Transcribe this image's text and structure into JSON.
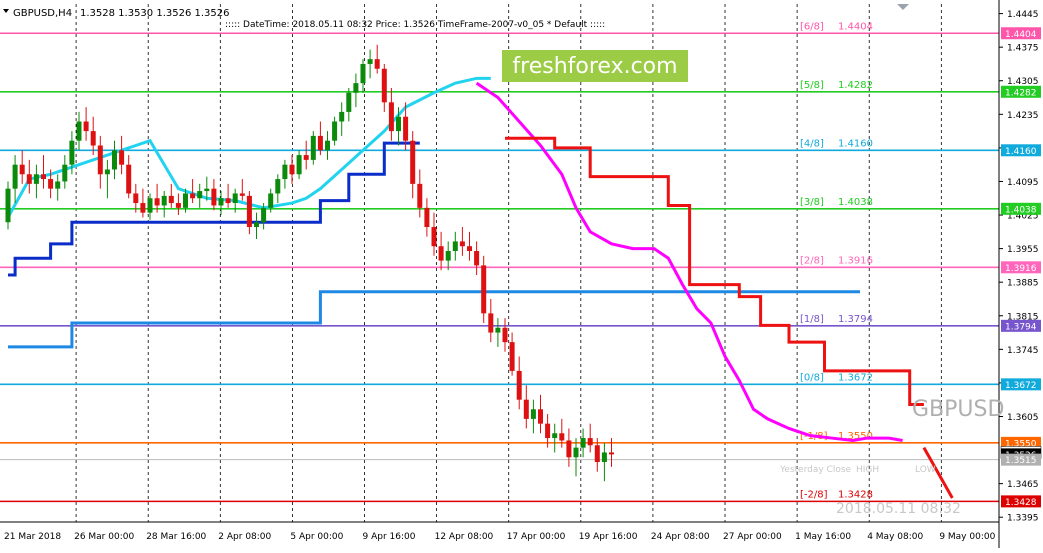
{
  "header": {
    "symbol": "GBPUSD,H4",
    "ohlc": "1.3528 1.3530 1.3526 1.3526",
    "info": ":::::  DateTime: 2018.05.11 08:32    Price: 1.3526   TimeFrame-2007-v0_05    *    Default    :::::"
  },
  "watermark": "freshforex.com",
  "symbol_label": "GBPUSD",
  "datetime_overlay": "2018.05.11 08:32",
  "colors": {
    "bull": "#0b8a0b",
    "bear": "#dd1111",
    "blue_line": "#0a2cc8",
    "lightblue_line": "#1e88e5",
    "cyan_line": "#22d3f0",
    "magenta_line": "#ff00ff",
    "red_line": "#ee1111"
  },
  "chart_data": {
    "type": "candlestick",
    "ylim": [
      1.3385,
      1.4465
    ],
    "time_labels": [
      "21 Mar 2018",
      "26 Mar 00:00",
      "28 Mar 16:00",
      "2 Apr 08:00",
      "5 Apr 00:00",
      "9 Apr 16:00",
      "12 Apr 08:00",
      "17 Apr 00:00",
      "19 Apr 16:00",
      "24 Apr 08:00",
      "27 Apr 00:00",
      "1 May 16:00",
      "4 May 08:00",
      "9 May 00:00"
    ],
    "price_ticks": [
      "1.4445",
      "1.4375",
      "1.4305",
      "1.4235",
      "1.4165",
      "1.4095",
      "1.4025",
      "1.3955",
      "1.3885",
      "1.3815",
      "1.3745",
      "1.3675",
      "1.3605",
      "1.3465",
      "1.3395"
    ],
    "murrey_levels": [
      {
        "label": "[6/8]",
        "price": 1.4404,
        "tag": "1.4404",
        "color": "#ff55aa"
      },
      {
        "label": "[5/8]",
        "price": 1.4282,
        "tag": "1.4282",
        "color": "#22cc22"
      },
      {
        "label": "[4/8]",
        "price": 1.416,
        "tag": "1.4160",
        "color": "#11aadd"
      },
      {
        "label": "[3/8]",
        "price": 1.4038,
        "tag": "1.4038",
        "color": "#22cc22"
      },
      {
        "label": "[2/8]",
        "price": 1.3916,
        "tag": "1.3916",
        "color": "#ff66bb"
      },
      {
        "label": "[1/8]",
        "price": 1.3794,
        "tag": "1.3794",
        "color": "#7755cc"
      },
      {
        "label": "[0/8]",
        "price": 1.3672,
        "tag": "1.3672",
        "color": "#11aadd"
      },
      {
        "label": "[-1/8]",
        "price": 1.355,
        "tag": "1.3550",
        "color": "#ff6600"
      },
      {
        "label": "[-2/8]",
        "price": 1.3428,
        "tag": "1.3428",
        "color": "#dd0000"
      }
    ],
    "extra_price_tags": [
      {
        "price": 1.353,
        "tag": "1.3530",
        "bg": "#ffffff",
        "fg": "#000000"
      },
      {
        "price": 1.3526,
        "tag": "1.3526",
        "bg": "#000000",
        "fg": "#ffffff"
      },
      {
        "price": 1.3515,
        "tag": "1.3515",
        "bg": "#b0b0b0",
        "fg": "#ffffff"
      }
    ],
    "yesterday_label": "Yesterday Close",
    "hi_label": "HIGH",
    "low_label": "LOW",
    "candles": [
      [
        1.401,
        1.4095,
        1.3995,
        1.408
      ],
      [
        1.408,
        1.415,
        1.405,
        1.413
      ],
      [
        1.413,
        1.416,
        1.409,
        1.411
      ],
      [
        1.411,
        1.414,
        1.407,
        1.409
      ],
      [
        1.409,
        1.413,
        1.406,
        1.411
      ],
      [
        1.411,
        1.415,
        1.408,
        1.41
      ],
      [
        1.41,
        1.412,
        1.406,
        1.408
      ],
      [
        1.408,
        1.411,
        1.4055,
        1.4095
      ],
      [
        1.4095,
        1.415,
        1.408,
        1.413
      ],
      [
        1.413,
        1.42,
        1.411,
        1.418
      ],
      [
        1.418,
        1.424,
        1.416,
        1.422
      ],
      [
        1.422,
        1.425,
        1.418,
        1.42
      ],
      [
        1.42,
        1.423,
        1.415,
        1.417
      ],
      [
        1.417,
        1.419,
        1.408,
        1.411
      ],
      [
        1.411,
        1.414,
        1.406,
        1.412
      ],
      [
        1.412,
        1.418,
        1.41,
        1.416
      ],
      [
        1.416,
        1.419,
        1.411,
        1.413
      ],
      [
        1.413,
        1.415,
        1.406,
        1.407
      ],
      [
        1.407,
        1.409,
        1.403,
        1.405
      ],
      [
        1.405,
        1.408,
        1.402,
        1.403
      ],
      [
        1.403,
        1.407,
        1.4015,
        1.406
      ],
      [
        1.406,
        1.409,
        1.403,
        1.4045
      ],
      [
        1.4045,
        1.4075,
        1.402,
        1.4065
      ],
      [
        1.4065,
        1.409,
        1.404,
        1.405
      ],
      [
        1.405,
        1.407,
        1.4025,
        1.404
      ],
      [
        1.404,
        1.408,
        1.403,
        1.407
      ],
      [
        1.407,
        1.41,
        1.405,
        1.406
      ],
      [
        1.406,
        1.409,
        1.404,
        1.4075
      ],
      [
        1.4075,
        1.4105,
        1.4055,
        1.408
      ],
      [
        1.408,
        1.41,
        1.4035,
        1.4045
      ],
      [
        1.4045,
        1.4075,
        1.4025,
        1.406
      ],
      [
        1.406,
        1.409,
        1.404,
        1.405
      ],
      [
        1.405,
        1.408,
        1.403,
        1.407
      ],
      [
        1.407,
        1.41,
        1.4055,
        1.4065
      ],
      [
        1.4065,
        1.4075,
        1.3985,
        1.4
      ],
      [
        1.4,
        1.403,
        1.3975,
        1.401
      ],
      [
        1.401,
        1.405,
        1.3995,
        1.404
      ],
      [
        1.404,
        1.408,
        1.403,
        1.407
      ],
      [
        1.407,
        1.411,
        1.405,
        1.41
      ],
      [
        1.41,
        1.414,
        1.408,
        1.413
      ],
      [
        1.413,
        1.415,
        1.409,
        1.411
      ],
      [
        1.411,
        1.416,
        1.41,
        1.415
      ],
      [
        1.415,
        1.418,
        1.412,
        1.414
      ],
      [
        1.414,
        1.42,
        1.413,
        1.419
      ],
      [
        1.419,
        1.422,
        1.415,
        1.416
      ],
      [
        1.416,
        1.42,
        1.414,
        1.418
      ],
      [
        1.418,
        1.423,
        1.417,
        1.422
      ],
      [
        1.422,
        1.426,
        1.419,
        1.424
      ],
      [
        1.424,
        1.429,
        1.422,
        1.428
      ],
      [
        1.428,
        1.432,
        1.425,
        1.43
      ],
      [
        1.43,
        1.435,
        1.428,
        1.434
      ],
      [
        1.434,
        1.437,
        1.431,
        1.435
      ],
      [
        1.435,
        1.438,
        1.432,
        1.433
      ],
      [
        1.433,
        1.434,
        1.424,
        1.426
      ],
      [
        1.426,
        1.429,
        1.418,
        1.42
      ],
      [
        1.42,
        1.425,
        1.417,
        1.423
      ],
      [
        1.423,
        1.426,
        1.416,
        1.418
      ],
      [
        1.418,
        1.42,
        1.406,
        1.409
      ],
      [
        1.409,
        1.412,
        1.402,
        1.404
      ],
      [
        1.404,
        1.406,
        1.398,
        1.4
      ],
      [
        1.4,
        1.403,
        1.394,
        1.396
      ],
      [
        1.396,
        1.399,
        1.391,
        1.393
      ],
      [
        1.393,
        1.397,
        1.391,
        1.395
      ],
      [
        1.395,
        1.399,
        1.393,
        1.397
      ],
      [
        1.397,
        1.4,
        1.394,
        1.396
      ],
      [
        1.396,
        1.399,
        1.393,
        1.395
      ],
      [
        1.395,
        1.397,
        1.39,
        1.392
      ],
      [
        1.392,
        1.394,
        1.38,
        1.382
      ],
      [
        1.382,
        1.385,
        1.376,
        1.378
      ],
      [
        1.378,
        1.381,
        1.375,
        1.379
      ],
      [
        1.379,
        1.381,
        1.374,
        1.376
      ],
      [
        1.376,
        1.378,
        1.369,
        1.37
      ],
      [
        1.37,
        1.373,
        1.362,
        1.364
      ],
      [
        1.364,
        1.367,
        1.358,
        1.36
      ],
      [
        1.36,
        1.364,
        1.357,
        1.362
      ],
      [
        1.362,
        1.365,
        1.357,
        1.359
      ],
      [
        1.359,
        1.361,
        1.354,
        1.356
      ],
      [
        1.356,
        1.359,
        1.353,
        1.357
      ],
      [
        1.357,
        1.36,
        1.354,
        1.3555
      ],
      [
        1.3555,
        1.358,
        1.35,
        1.352
      ],
      [
        1.352,
        1.356,
        1.348,
        1.354
      ],
      [
        1.354,
        1.358,
        1.352,
        1.356
      ],
      [
        1.356,
        1.359,
        1.353,
        1.3545
      ],
      [
        1.3545,
        1.356,
        1.349,
        1.351
      ],
      [
        1.351,
        1.355,
        1.347,
        1.353
      ],
      [
        1.353,
        1.356,
        1.35,
        1.3526
      ]
    ],
    "blue_steps": [
      [
        0,
        1.39
      ],
      [
        1,
        1.3935
      ],
      [
        6,
        1.3965
      ],
      [
        9,
        1.401
      ],
      [
        24,
        1.401
      ],
      [
        40,
        1.401
      ],
      [
        44,
        1.4055
      ],
      [
        48,
        1.411
      ],
      [
        53,
        1.4175
      ],
      [
        58,
        1.4175
      ]
    ],
    "lightblue_steps": [
      [
        0,
        1.375
      ],
      [
        9,
        1.38
      ],
      [
        44,
        1.3865
      ],
      [
        120,
        1.3865
      ]
    ],
    "cyan_line": [
      [
        0,
        1.402
      ],
      [
        3,
        1.41
      ],
      [
        6,
        1.411
      ],
      [
        10,
        1.413
      ],
      [
        14,
        1.415
      ],
      [
        18,
        1.417
      ],
      [
        20,
        1.418
      ],
      [
        24,
        1.408
      ],
      [
        28,
        1.406
      ],
      [
        32,
        1.4055
      ],
      [
        36,
        1.404
      ],
      [
        40,
        1.405
      ],
      [
        42,
        1.406
      ],
      [
        44,
        1.408
      ],
      [
        47,
        1.412
      ],
      [
        50,
        1.416
      ],
      [
        53,
        1.42
      ],
      [
        56,
        1.425
      ],
      [
        60,
        1.428
      ],
      [
        63,
        1.43
      ],
      [
        66,
        1.431
      ],
      [
        68,
        1.431
      ]
    ],
    "magenta_line": [
      [
        66,
        1.43
      ],
      [
        69,
        1.427
      ],
      [
        72,
        1.422
      ],
      [
        75,
        1.417
      ],
      [
        78,
        1.411
      ],
      [
        80,
        1.404
      ],
      [
        82,
        1.399
      ],
      [
        85,
        1.3965
      ],
      [
        88,
        1.3955
      ],
      [
        91,
        1.3955
      ],
      [
        93,
        1.3935
      ],
      [
        95,
        1.388
      ],
      [
        97,
        1.383
      ],
      [
        99,
        1.38
      ],
      [
        101,
        1.373
      ],
      [
        103,
        1.368
      ],
      [
        105,
        1.362
      ],
      [
        107,
        1.36
      ],
      [
        110,
        1.358
      ],
      [
        113,
        1.3565
      ],
      [
        116,
        1.356
      ],
      [
        119,
        1.3555
      ],
      [
        121,
        1.356
      ],
      [
        124,
        1.356
      ],
      [
        126,
        1.3555
      ]
    ],
    "red_steps": [
      [
        70,
        1.4185
      ],
      [
        77,
        1.4165
      ],
      [
        82,
        1.4105
      ],
      [
        93,
        1.4045
      ],
      [
        96,
        1.388
      ],
      [
        103,
        1.3855
      ],
      [
        106,
        1.3795
      ],
      [
        110,
        1.376
      ],
      [
        115,
        1.37
      ],
      [
        127,
        1.37
      ],
      [
        127,
        1.363
      ],
      [
        129,
        1.363
      ]
    ],
    "red_projection": [
      [
        129,
        1.354
      ],
      [
        133,
        1.3435
      ]
    ]
  }
}
